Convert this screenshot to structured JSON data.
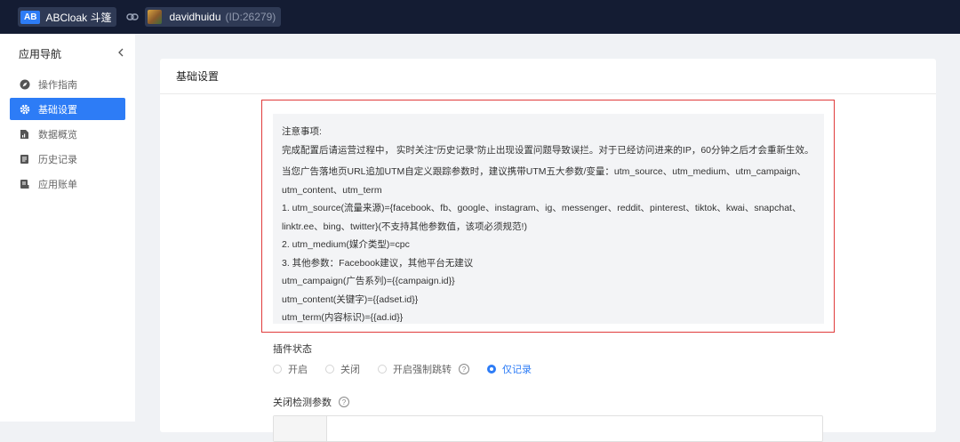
{
  "topbar": {
    "app_badge": "AB",
    "app_name": "ABCloak 斗篷",
    "link_icon": "link-icon",
    "user_name": "davidhuidu",
    "user_id": "(ID:26279)"
  },
  "sidebar": {
    "title": "应用导航",
    "collapse_icon": "chevron-left-icon",
    "items": [
      {
        "label": "操作指南",
        "icon": "compass-icon",
        "active": false
      },
      {
        "label": "基础设置",
        "icon": "gear-icon",
        "active": true
      },
      {
        "label": "数据概览",
        "icon": "chart-doc-icon",
        "active": false
      },
      {
        "label": "历史记录",
        "icon": "list-doc-icon",
        "active": false
      },
      {
        "label": "应用账单",
        "icon": "bill-icon",
        "active": false
      }
    ]
  },
  "main": {
    "title": "基础设置",
    "notice": {
      "heading": "注意事项:",
      "line1": "完成配置后请运营过程中， 实时关注“历史记录”防止出现设置问题导致误拦。对于已经访问进来的IP，60分钟之后才会重新生效。",
      "line2": "当您广告落地页URL追加UTM自定义跟踪参数时，建议携带UTM五大参数/变量：utm_source、utm_medium、utm_campaign、",
      "line3": "utm_content、utm_term",
      "line4": "1. utm_source(流量来源)={facebook、fb、google、instagram、ig、messenger、reddit、pinterest、tiktok、kwai、snapchat、",
      "line5": "linktr.ee、bing、twitter}(不支持其他参数值，该项必须规范!)",
      "line6": "2. utm_medium(媒介类型)=cpc",
      "line7": "3. 其他参数：Facebook建议，其他平台无建议",
      "line8": "utm_campaign(广告系列)={{campaign.id}}",
      "line9": "utm_content(关键字)={{adset.id}}",
      "line10": "utm_term(内容标识)={{ad.id}}"
    },
    "plugin_status_label": "插件状态",
    "plugin_options": [
      {
        "label": "开启",
        "checked": false
      },
      {
        "label": "关闭",
        "checked": false
      },
      {
        "label": "开启强制跳转",
        "checked": false,
        "help": true
      },
      {
        "label": "仅记录",
        "checked": true
      }
    ],
    "close_params_label": "关闭检测参数",
    "help_glyph": "?"
  },
  "colors": {
    "topbar": "#141c33",
    "accent": "#2d7cf6",
    "highlight_border": "#e03b3b"
  }
}
